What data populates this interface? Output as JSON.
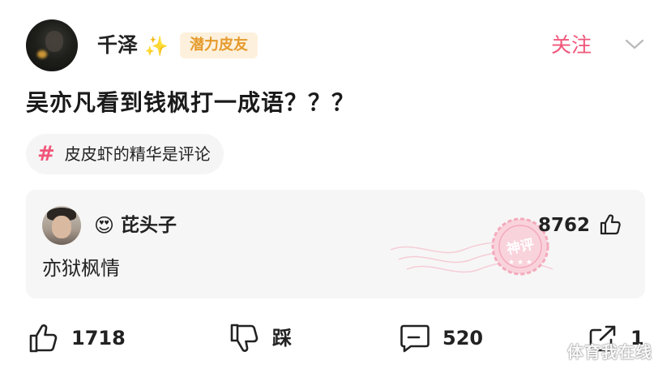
{
  "post": {
    "user_name": "千泽",
    "name_decoration": "✨",
    "user_badge": "潜力皮友",
    "follow_label": "关注",
    "text": "吴亦凡看到钱枫打一成语？？？",
    "topic_symbol": "#",
    "topic": "皮皮虾的精华是评论"
  },
  "comment": {
    "emoji": "😍",
    "user_name": "芘头子",
    "likes": "8762",
    "text": "亦狱枫情",
    "stamp_text": "神评",
    "stamp_color": "#f4a9bb"
  },
  "actions": {
    "like_count": "1718",
    "dislike_label": "踩",
    "comment_count": "520",
    "share_count": "1"
  },
  "watermark": "体育我在线",
  "colors": {
    "accent_pink": "#f0567a",
    "badge_bg": "#fdf1dd",
    "badge_text": "#e59a2c"
  }
}
